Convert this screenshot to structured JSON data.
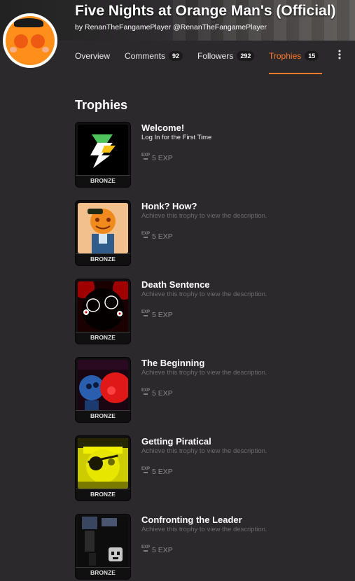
{
  "game": {
    "title": "Five Nights at Orange Man's (Official)",
    "by_prefix": "by",
    "developer": "RenanTheFangamePlayer",
    "handle": "@RenanTheFangamePlayer"
  },
  "tabs": [
    {
      "label": "Overview",
      "count": null,
      "active": false
    },
    {
      "label": "Comments",
      "count": "92",
      "active": false
    },
    {
      "label": "Followers",
      "count": "292",
      "active": false
    },
    {
      "label": "Trophies",
      "count": "15",
      "active": true
    }
  ],
  "more_menu_icon": "kebab-vertical-icon",
  "section_title": "Trophies",
  "trophies": [
    {
      "name": "Welcome!",
      "description": "Log In for the First Time",
      "unlocked": true,
      "exp": "5 EXP",
      "rank": "BRONZE"
    },
    {
      "name": "Honk? How?",
      "description": "Achieve this trophy to view the description.",
      "unlocked": false,
      "exp": "5 EXP",
      "rank": "BRONZE"
    },
    {
      "name": "Death Sentence",
      "description": "Achieve this trophy to view the description.",
      "unlocked": false,
      "exp": "5 EXP",
      "rank": "BRONZE"
    },
    {
      "name": "The Beginning",
      "description": "Achieve this trophy to view the description.",
      "unlocked": false,
      "exp": "5 EXP",
      "rank": "BRONZE"
    },
    {
      "name": "Getting Piratical",
      "description": "Achieve this trophy to view the description.",
      "unlocked": false,
      "exp": "5 EXP",
      "rank": "BRONZE"
    },
    {
      "name": "Confronting the Leader",
      "description": "Achieve this trophy to view the description.",
      "unlocked": false,
      "exp": "5 EXP",
      "rank": "BRONZE"
    }
  ],
  "exp_icon_text": "EXP",
  "colors": {
    "accent": "#ff7a2c",
    "background": "#2b292b",
    "muted_text": "#6d6b6c"
  }
}
